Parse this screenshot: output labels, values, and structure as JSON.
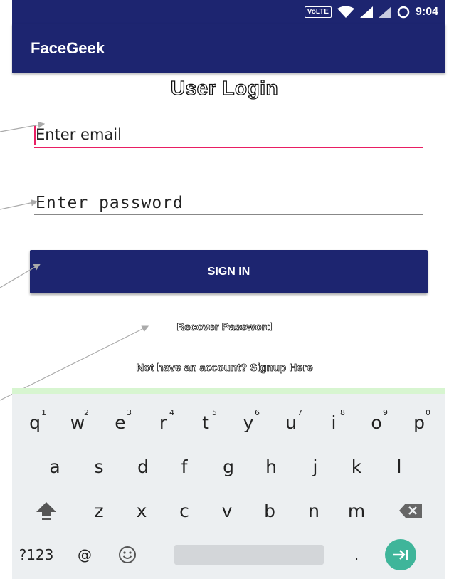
{
  "status_bar": {
    "network_badge": "VoLTE",
    "time": "9:04"
  },
  "app_bar": {
    "title": "FaceGeek"
  },
  "login": {
    "title": "User Login",
    "email_placeholder": "Enter email",
    "password_placeholder": "Enter password",
    "signin_label": "SIGN IN",
    "recover_label": "Recover Password",
    "signup_label": "Not have an account? Signup Here"
  },
  "colors": {
    "primary": "#1d2570",
    "accent": "#e91e63",
    "keyboard_bg": "#eceff1",
    "enter_key": "#3fb59a"
  },
  "keyboard": {
    "row1": [
      {
        "key": "q",
        "hint": "1"
      },
      {
        "key": "w",
        "hint": "2"
      },
      {
        "key": "e",
        "hint": "3"
      },
      {
        "key": "r",
        "hint": "4"
      },
      {
        "key": "t",
        "hint": "5"
      },
      {
        "key": "y",
        "hint": "6"
      },
      {
        "key": "u",
        "hint": "7"
      },
      {
        "key": "i",
        "hint": "8"
      },
      {
        "key": "o",
        "hint": "9"
      },
      {
        "key": "p",
        "hint": "0"
      }
    ],
    "row2": [
      "a",
      "s",
      "d",
      "f",
      "g",
      "h",
      "j",
      "k",
      "l"
    ],
    "row3": [
      "z",
      "x",
      "c",
      "v",
      "b",
      "n",
      "m"
    ],
    "symbols_label": "?123",
    "at_label": "@",
    "period_label": ".",
    "icons": {
      "shift": "shift-icon",
      "backspace": "backspace-icon",
      "emoji": "emoji-icon",
      "enter": "enter-arrow-icon"
    }
  }
}
